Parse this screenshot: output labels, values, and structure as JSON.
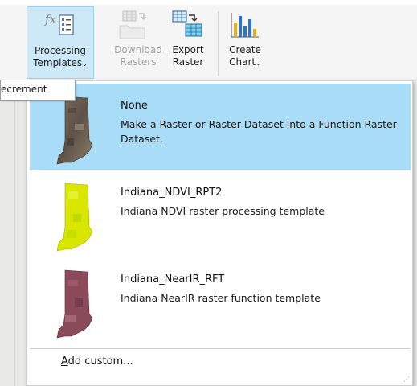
{
  "ribbon": {
    "processing_templates": {
      "line1": "Processing",
      "line2": "Templates",
      "caret": "⌄",
      "icon": "function-template-icon"
    },
    "download_rasters": {
      "line1": "Download",
      "line2": "Rasters",
      "icon": "download-rasters-icon"
    },
    "export_raster": {
      "line1": "Export",
      "line2": "Raster",
      "icon": "export-raster-icon"
    },
    "create_chart": {
      "line1": "Create",
      "line2": "Chart",
      "caret": "⌄",
      "icon": "bar-chart-icon"
    }
  },
  "tooltip": {
    "text": "ecrement"
  },
  "gallery": {
    "items": [
      {
        "title": "None",
        "description": "Make a Raster or Raster Dataset into a Function Raster Dataset.",
        "selected": true,
        "thumb_color": "#6e5a4a"
      },
      {
        "title": "Indiana_NDVI_RPT2",
        "description": "Indiana NDVI raster processing template",
        "selected": false,
        "thumb_color": "#d8e600"
      },
      {
        "title": "Indiana_NearIR_RFT",
        "description": "Indiana NearIR raster function template",
        "selected": false,
        "thumb_color": "#8a4a5a"
      }
    ],
    "add_custom": "Add custom...",
    "add_custom_mnemonic": "A",
    "add_custom_rest": "dd custom..."
  },
  "colors": {
    "selected_bg": "#a9dcf7",
    "ribbon_active": "#cde8f6"
  }
}
